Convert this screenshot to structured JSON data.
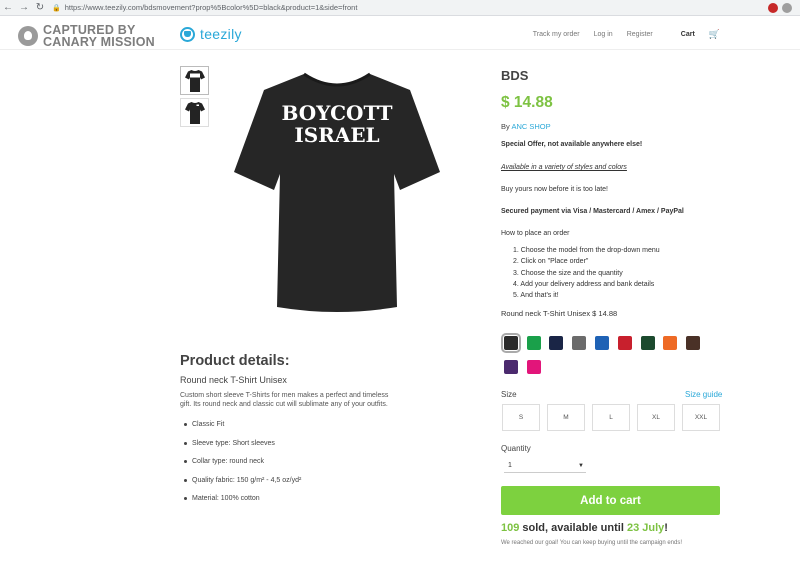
{
  "browser": {
    "url": "https://www.teezily.com/bdsmovement?prop%5Bcolor%5D=black&product=1&side=front"
  },
  "watermark": {
    "line1": "CAPTURED BY",
    "line2": "CANARY MISSION"
  },
  "header": {
    "brand": "teezily",
    "nav": [
      "Track my order",
      "Log in",
      "Register"
    ],
    "cart_label": "Cart"
  },
  "shirt_print": {
    "line1": "BOYCOTT",
    "line2": "ISRAEL"
  },
  "product_details": {
    "heading": "Product details:",
    "subheading": "Round neck T-Shirt Unisex",
    "description": "Custom short sleeve T-Shirts for men makes a perfect and timeless gift. Its round neck and classic cut will sublimate any of your outfits.",
    "features": [
      "Classic Fit",
      "Sleeve type: Short sleeves",
      "Collar type: round neck",
      "Quality fabric: 150 g/m² - 4,5 oz/yd²",
      "Material: 100% cotton"
    ]
  },
  "product": {
    "title": "BDS",
    "price": "$ 14.88",
    "by_prefix": "By",
    "seller": "ANC SHOP",
    "offer": "Special Offer, not available anywhere else!",
    "available": "Available in a variety of styles and colors",
    "buy_now": "Buy yours now before it is too late!",
    "payment": "Secured payment via Visa / Mastercard / Amex / PayPal",
    "how_to": "How to place an order",
    "steps": [
      "1. Choose the model from the drop-down menu",
      "2. Click on \"Place order\"",
      "3. Choose the size and the quantity",
      "4. Add your delivery address and bank details",
      "5. And that's it!"
    ],
    "variant": "Round neck T-Shirt Unisex $ 14.88"
  },
  "colors": [
    "#2b2b2b",
    "#1aa04a",
    "#1a2546",
    "#6b6b6b",
    "#1f62b5",
    "#c8202d",
    "#1c4a2e",
    "#ee6a25",
    "#4a3127",
    "#4b2a6e",
    "#e2157a"
  ],
  "size": {
    "label": "Size",
    "guide": "Size guide",
    "options": [
      "S",
      "M",
      "L",
      "XL",
      "XXL"
    ]
  },
  "quantity": {
    "label": "Quantity",
    "value": "1"
  },
  "add_to_cart": "Add to cart",
  "sales": {
    "count": "109",
    "middle": " sold, available until ",
    "date": "23 July",
    "end": "!",
    "goal": "We reached our goal! You can keep buying until the campaign ends!"
  }
}
